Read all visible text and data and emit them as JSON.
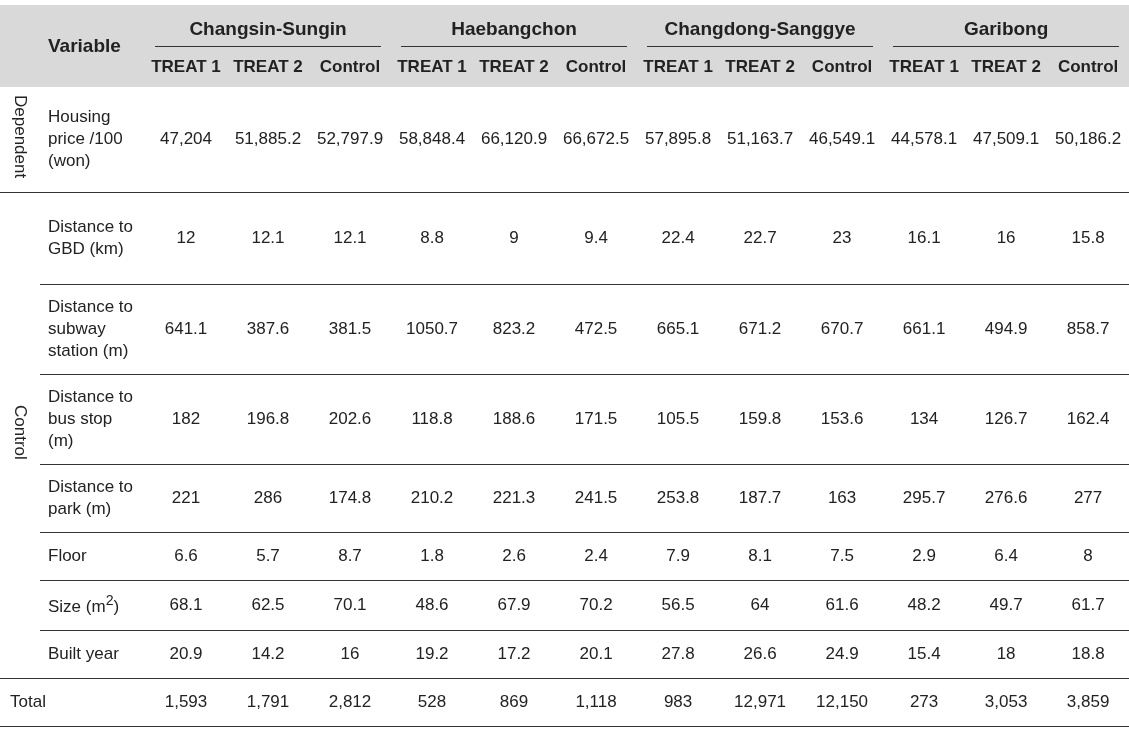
{
  "table": {
    "variable_header": "Variable",
    "groups": [
      {
        "name": "Changsin-Sungin",
        "columns": [
          "TREAT 1",
          "TREAT 2",
          "Control"
        ]
      },
      {
        "name": "Haebangchon",
        "columns": [
          "TREAT 1",
          "TREAT 2",
          "Control"
        ]
      },
      {
        "name": "Changdong-Sanggye",
        "columns": [
          "TREAT 1",
          "TREAT 2",
          "Control"
        ]
      },
      {
        "name": "Garibong",
        "columns": [
          "TREAT 1",
          "TREAT 2",
          "Control"
        ]
      }
    ],
    "sections": [
      {
        "label": "Dependent",
        "rows": [
          {
            "variable": "Housing price /100 (won)",
            "values": [
              "47,204",
              "51,885.2",
              "52,797.9",
              "58,848.4",
              "66,120.9",
              "66,672.5",
              "57,895.8",
              "51,163.7",
              "46,549.1",
              "44,578.1",
              "47,509.1",
              "50,186.2"
            ]
          }
        ]
      },
      {
        "label": "Control",
        "rows": [
          {
            "variable": "Distance to GBD (km)",
            "values": [
              "12",
              "12.1",
              "12.1",
              "8.8",
              "9",
              "9.4",
              "22.4",
              "22.7",
              "23",
              "16.1",
              "16",
              "15.8"
            ]
          },
          {
            "variable": "Distance to subway station (m)",
            "values": [
              "641.1",
              "387.6",
              "381.5",
              "1050.7",
              "823.2",
              "472.5",
              "665.1",
              "671.2",
              "670.7",
              "661.1",
              "494.9",
              "858.7"
            ]
          },
          {
            "variable": "Distance to bus stop (m)",
            "values": [
              "182",
              "196.8",
              "202.6",
              "118.8",
              "188.6",
              "171.5",
              "105.5",
              "159.8",
              "153.6",
              "134",
              "126.7",
              "162.4"
            ]
          },
          {
            "variable": "Distance to park (m)",
            "values": [
              "221",
              "286",
              "174.8",
              "210.2",
              "221.3",
              "241.5",
              "253.8",
              "187.7",
              "163",
              "295.7",
              "276.6",
              "277"
            ]
          },
          {
            "variable": "Floor",
            "values": [
              "6.6",
              "5.7",
              "8.7",
              "1.8",
              "2.6",
              "2.4",
              "7.9",
              "8.1",
              "7.5",
              "2.9",
              "6.4",
              "8"
            ]
          },
          {
            "variable": "Size (m$^{2}$)",
            "values": [
              "68.1",
              "62.5",
              "70.1",
              "48.6",
              "67.9",
              "70.2",
              "56.5",
              "64",
              "61.6",
              "48.2",
              "49.7",
              "61.7"
            ]
          },
          {
            "variable": "Built year",
            "values": [
              "20.9",
              "14.2",
              "16",
              "19.2",
              "17.2",
              "20.1",
              "27.8",
              "26.6",
              "24.9",
              "15.4",
              "18",
              "18.8"
            ]
          }
        ]
      }
    ],
    "total": {
      "label": "Total",
      "values": [
        "1,593",
        "1,791",
        "2,812",
        "528",
        "869",
        "1,118",
        "983",
        "12,971",
        "12,150",
        "273",
        "3,053",
        "3,859"
      ]
    }
  }
}
